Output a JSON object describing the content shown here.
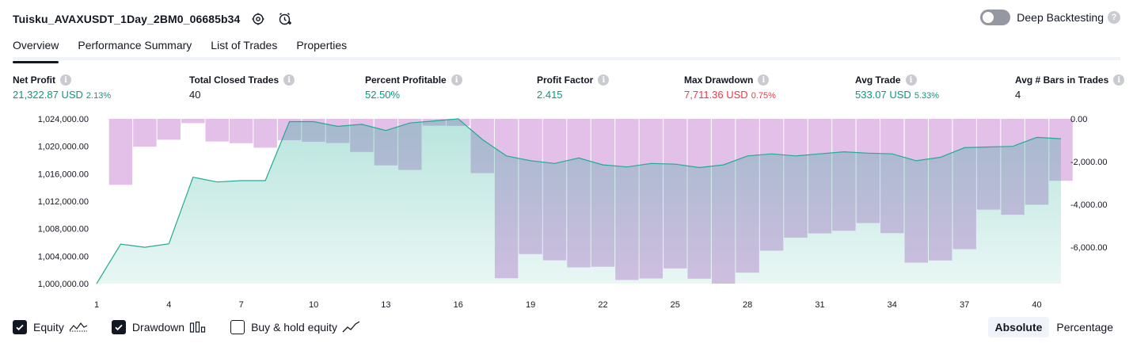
{
  "header": {
    "title": "Tuisku_AVAXUSDT_1Day_2BM0_06685b34",
    "deep_backtesting_label": "Deep Backtesting",
    "help_glyph": "?"
  },
  "tabs": [
    {
      "label": "Overview",
      "active": true
    },
    {
      "label": "Performance Summary",
      "active": false
    },
    {
      "label": "List of Trades",
      "active": false
    },
    {
      "label": "Properties",
      "active": false
    }
  ],
  "metrics": [
    {
      "label": "Net Profit",
      "value": "21,322.87 USD",
      "sub": "2.13%",
      "tone": "pos"
    },
    {
      "label": "Total Closed Trades",
      "value": "40",
      "sub": "",
      "tone": "neutral"
    },
    {
      "label": "Percent Profitable",
      "value": "52.50%",
      "sub": "",
      "tone": "pos"
    },
    {
      "label": "Profit Factor",
      "value": "2.415",
      "sub": "",
      "tone": "pos"
    },
    {
      "label": "Max Drawdown",
      "value": "7,711.36 USD",
      "sub": "0.75%",
      "tone": "neg"
    },
    {
      "label": "Avg Trade",
      "value": "533.07 USD",
      "sub": "5.33%",
      "tone": "pos"
    },
    {
      "label": "Avg # Bars in Trades",
      "value": "4",
      "sub": "",
      "tone": "neutral"
    }
  ],
  "info_glyph": "i",
  "chart_data": {
    "type": "area",
    "x_ticks": [
      1,
      4,
      7,
      10,
      13,
      16,
      19,
      22,
      25,
      28,
      31,
      34,
      37,
      40
    ],
    "x_range": [
      1,
      41
    ],
    "left_axis": {
      "ticks": [
        "1,024,000.00",
        "1,020,000.00",
        "1,016,000.00",
        "1,012,000.00",
        "1,008,000.00",
        "1,004,000.00",
        "1,000,000.00"
      ],
      "range": [
        1000000,
        1024000
      ]
    },
    "right_axis": {
      "ticks": [
        "0.00",
        "-2,000.00",
        "-4,000.00",
        "-6,000.00"
      ],
      "range": [
        -7711.36,
        0
      ]
    },
    "series": [
      {
        "name": "Equity",
        "type": "area",
        "color": "#22ab94",
        "x": [
          1,
          2,
          3,
          4,
          5,
          6,
          7,
          8,
          9,
          10,
          11,
          12,
          13,
          14,
          15,
          16,
          17,
          18,
          19,
          20,
          21,
          22,
          23,
          24,
          25,
          26,
          27,
          28,
          29,
          30,
          31,
          32,
          33,
          34,
          35,
          36,
          37,
          38,
          39,
          40,
          41
        ],
        "values": [
          1000000,
          1005750,
          1005300,
          1005800,
          1015500,
          1014800,
          1015000,
          1015000,
          1023600,
          1023600,
          1022900,
          1023200,
          1022300,
          1023400,
          1023700,
          1024000,
          1021000,
          1018600,
          1017900,
          1017500,
          1018300,
          1017300,
          1017000,
          1017500,
          1017400,
          1016900,
          1017300,
          1018600,
          1018900,
          1018600,
          1018900,
          1019200,
          1019000,
          1018900,
          1017900,
          1018400,
          1019800,
          1019900,
          1020000,
          1021300,
          1021100
        ]
      },
      {
        "name": "Drawdown",
        "type": "bar",
        "color": "#ba68c8",
        "x": [
          2,
          3,
          4,
          5,
          6,
          7,
          8,
          9,
          10,
          11,
          12,
          13,
          14,
          15,
          16,
          17,
          18,
          19,
          20,
          21,
          22,
          23,
          24,
          25,
          26,
          27,
          28,
          29,
          30,
          31,
          32,
          33,
          34,
          35,
          36,
          37,
          38,
          39,
          40,
          41
        ],
        "values": [
          -3090,
          -1300,
          -980,
          -200,
          -1060,
          -1140,
          -1350,
          -1000,
          -1070,
          -1130,
          -1550,
          -2180,
          -2390,
          -320,
          -330,
          -2540,
          -7460,
          -6330,
          -6620,
          -6950,
          -6920,
          -7540,
          -7470,
          -7000,
          -7480,
          -7711.36,
          -7200,
          -6170,
          -5560,
          -5360,
          -5240,
          -4880,
          -5350,
          -6730,
          -6630,
          -6100,
          -4250,
          -4490,
          -4020,
          -2900
        ]
      }
    ]
  },
  "legend": {
    "equity_label": "Equity",
    "equity_checked": true,
    "drawdown_label": "Drawdown",
    "drawdown_checked": true,
    "bh_label": "Buy & hold equity",
    "bh_checked": false
  },
  "mode": {
    "absolute_label": "Absolute",
    "percentage_label": "Percentage",
    "active": "absolute"
  },
  "colors": {
    "equity_line": "#22ab94",
    "equity_fill": "#22ab94",
    "drawdown_fill": "#ba68c8",
    "positive": "#089981",
    "negative": "#f23645"
  },
  "icons": [
    "settings-icon",
    "alert-clock-icon",
    "info-icon",
    "help-icon",
    "check-icon",
    "equity-glyph-icon",
    "drawdown-glyph-icon",
    "buy-hold-glyph-icon"
  ]
}
